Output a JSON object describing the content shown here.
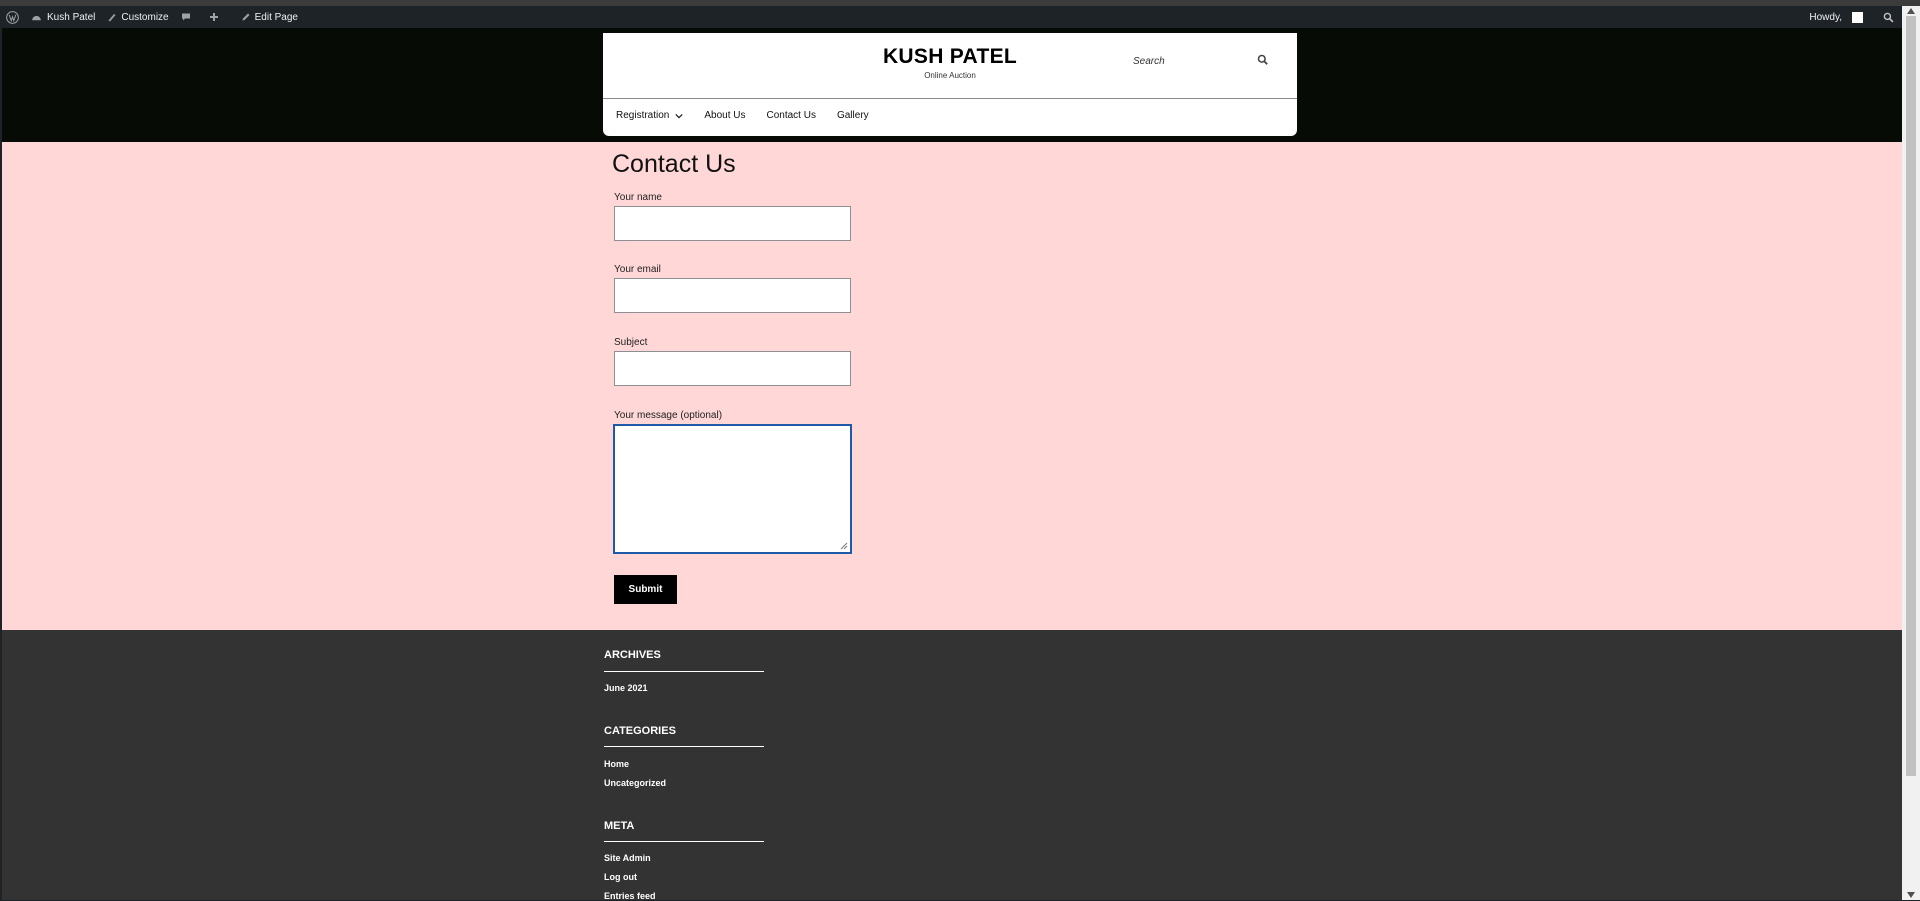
{
  "admin_bar": {
    "site_name": "Kush Patel",
    "customize": "Customize",
    "edit_page": "Edit Page",
    "howdy": "Howdy,"
  },
  "header": {
    "site_title": "KUSH PATEL",
    "tagline": "Online Auction",
    "search_label": "Search"
  },
  "nav": {
    "items": [
      {
        "label": "Registration",
        "has_submenu": true
      },
      {
        "label": "About Us"
      },
      {
        "label": "Contact Us"
      },
      {
        "label": "Gallery"
      }
    ]
  },
  "page": {
    "title": "Contact Us"
  },
  "form": {
    "name_label": "Your name",
    "name_value": "",
    "email_label": "Your email",
    "email_value": "",
    "subject_label": "Subject",
    "subject_value": "",
    "message_label": "Your message (optional)",
    "message_value": "",
    "submit_label": "Submit"
  },
  "footer": {
    "archives": {
      "title": "ARCHIVES",
      "links": [
        "June 2021"
      ]
    },
    "categories": {
      "title": "CATEGORIES",
      "links": [
        "Home",
        "Uncategorized"
      ]
    },
    "meta": {
      "title": "META",
      "links": [
        "Site Admin",
        "Log out",
        "Entries feed"
      ]
    }
  },
  "colors": {
    "admin_bar": "#1d2327",
    "header_band": "#060b06",
    "content_bg": "#ffd7d7",
    "footer_bg": "#333333",
    "button_bg": "#000000",
    "focus_border": "#1e5aa8"
  }
}
